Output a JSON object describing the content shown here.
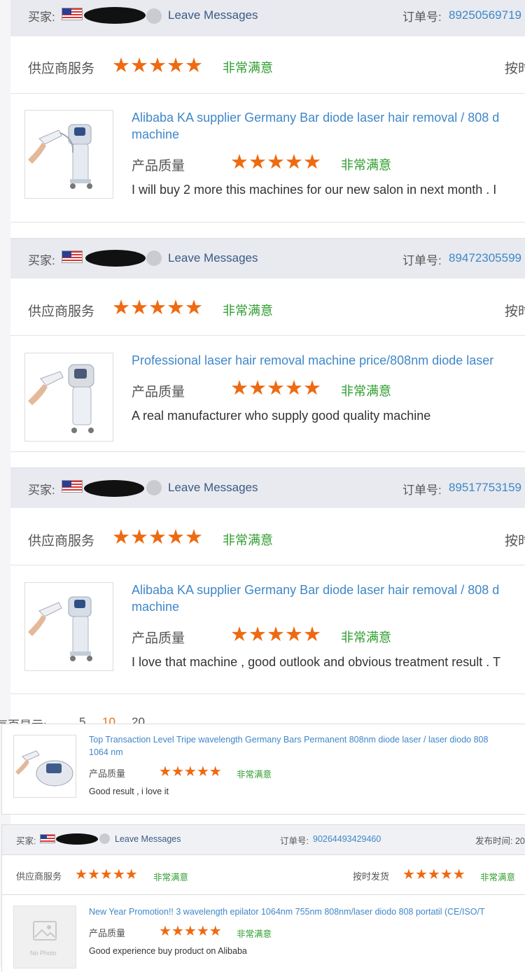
{
  "colors": {
    "accent_star": "#ee6a11",
    "link": "#3f87c8",
    "satisfied": "#2f9d2f",
    "header_bg": "#e8eaef"
  },
  "labels": {
    "buyer": "买家:",
    "leave_messages": "Leave Messages",
    "order_no": "订单号:",
    "supplier_service": "供应商服务",
    "product_quality": "产品质量",
    "very_satisfied": "非常满意",
    "on_time_partial": "按时",
    "on_time_ship": "按时发货",
    "publish_time": "发布时间: 20",
    "per_page": "每页显示:",
    "no_photo": "No Photo"
  },
  "pager": {
    "options": [
      "5",
      "10",
      "20"
    ]
  },
  "reviews": [
    {
      "order_no": "89250569719",
      "product": "Alibaba KA supplier Germany Bar diode laser hair removal / 808 d",
      "product_line2": "machine",
      "comment": "I will buy 2 more this machines for our new salon in next month . I",
      "service_stars": 5,
      "quality_stars": 5
    },
    {
      "order_no": "89472305599",
      "product": "Professional laser hair removal machine price/808nm diode laser",
      "product_line2": "",
      "comment": "A real manufacturer who supply good quality machine",
      "service_stars": 5,
      "quality_stars": 5
    },
    {
      "order_no": "89517753159",
      "product": "Alibaba KA supplier Germany Bar diode laser hair removal / 808 d",
      "product_line2": "machine",
      "comment": "I love that machine , good outlook and obvious treatment result . T",
      "service_stars": 5,
      "quality_stars": 5
    }
  ],
  "small_reviews": [
    {
      "product": "Top Transaction Level Tripe wavelength Germany Bars Permanent 808nm diode laser / laser diodo 808",
      "product_line2": "1064 nm",
      "comment": "Good result , i love it",
      "quality_stars": 5
    },
    {
      "order_no": "90264493429460",
      "product": "New Year Promotion!! 3 wavelength epilator 1064nm 755nm 808nm/laser diodo 808 portatil (CE/ISO/T",
      "comment": "Good experience buy product on Alibaba",
      "service_stars": 5,
      "ship_stars": 5,
      "quality_stars": 5
    }
  ]
}
